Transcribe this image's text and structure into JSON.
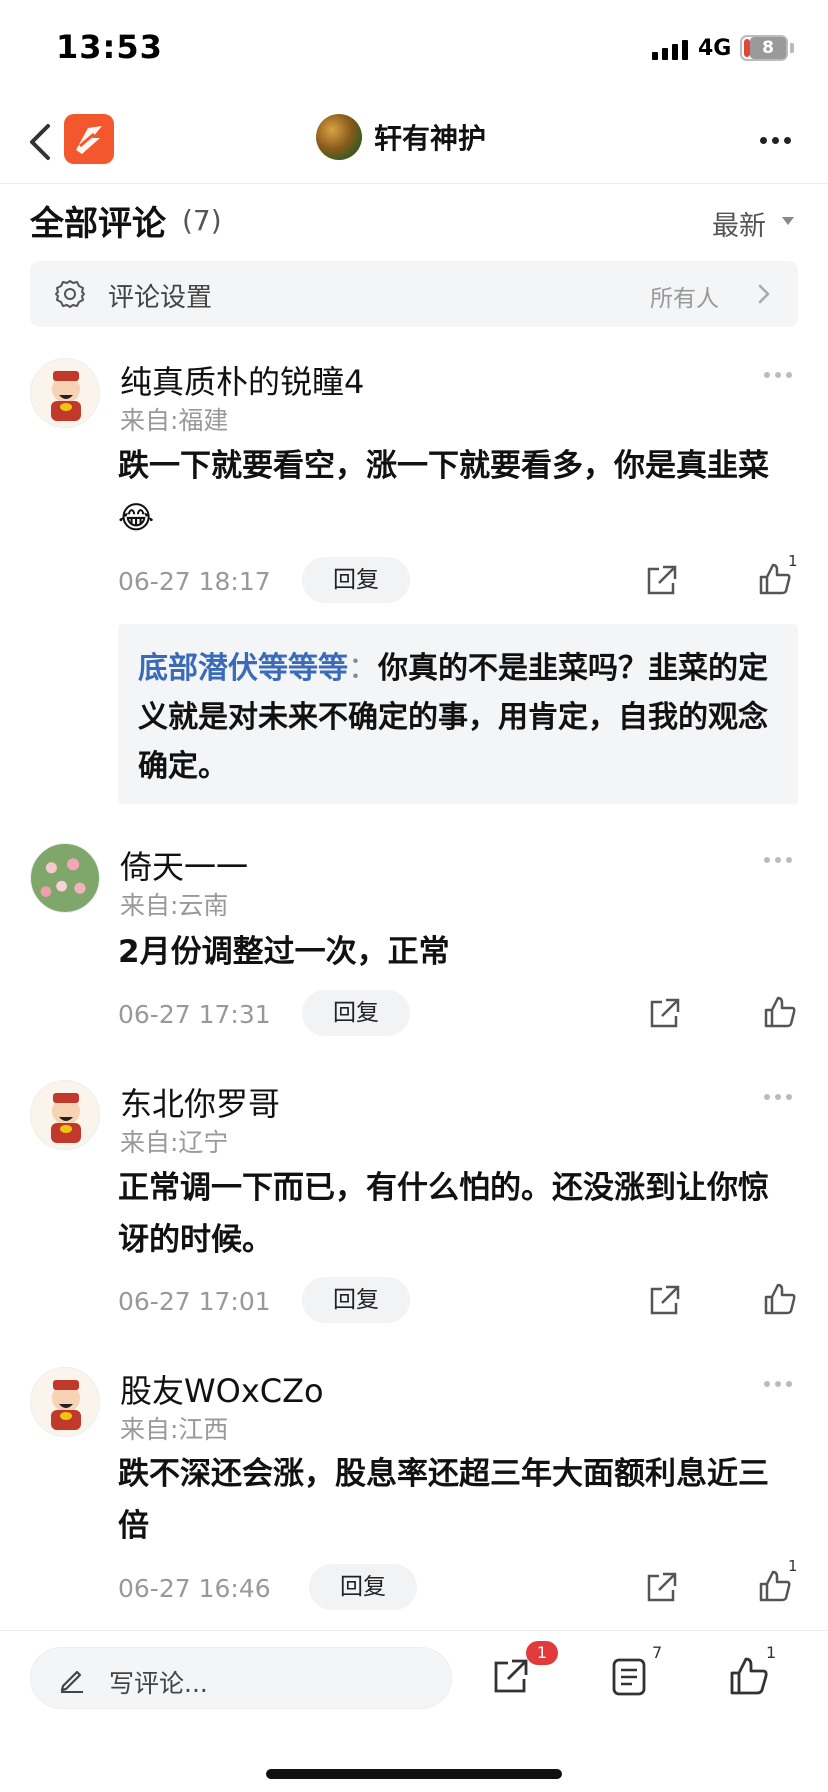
{
  "status_bar": {
    "time": "13:53",
    "network": "4G",
    "battery": "8"
  },
  "nav": {
    "title": "轩有神护"
  },
  "section": {
    "title": "全部评论",
    "count": "(7)",
    "sort_label": "最新"
  },
  "settings": {
    "label": "评论设置",
    "value": "所有人"
  },
  "comments": [
    {
      "name": "纯真质朴的锐瞳4",
      "location": "来自:福建",
      "text": "跌一下就要看空，涨一下就要看多，你是真韭菜😂",
      "time": "06-27 18:17",
      "reply_label": "回复",
      "likes": "1",
      "sub_reply": {
        "author": "底部潜伏等等等",
        "colon": "：",
        "text": "你真的不是韭菜吗？韭菜的定义就是对未来不确定的事，用肯定，自我的观念确定。"
      }
    },
    {
      "name": "倚天一一",
      "location": "来自:云南",
      "text": "2月份调整过一次，正常",
      "time": "06-27 17:31",
      "reply_label": "回复",
      "likes": ""
    },
    {
      "name": "东北你罗哥",
      "location": "来自:辽宁",
      "text": "正常调一下而已，有什么怕的。还没涨到让你惊讶的时候。",
      "time": "06-27 17:01",
      "reply_label": "回复",
      "likes": ""
    },
    {
      "name": "股友WOxCZo",
      "location": "来自:江西",
      "text": "跌不深还会涨，股息率还超三年大面额利息近三倍",
      "time": "06-27 16:46",
      "reply_label": "回复",
      "likes": "1"
    }
  ],
  "bottom_bar": {
    "placeholder": "写评论...",
    "share_badge": "1",
    "comment_count": "7",
    "like_count": "1"
  },
  "colors": {
    "accent": "#f2572d",
    "link": "#3b6bb8",
    "badge": "#e03a3a"
  }
}
